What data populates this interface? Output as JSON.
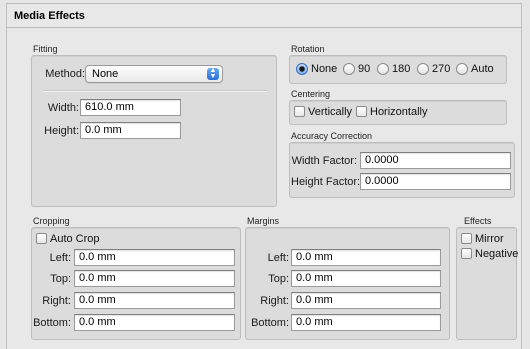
{
  "title": "Media Effects",
  "fitting": {
    "group_label": "Fitting",
    "method_label": "Method:",
    "method_value": "None",
    "width_label": "Width:",
    "width_value": "610.0 mm",
    "height_label": "Height:",
    "height_value": "0.0 mm"
  },
  "rotation": {
    "group_label": "Rotation",
    "options": [
      "None",
      "90",
      "180",
      "270",
      "Auto"
    ],
    "selected": "None"
  },
  "centering": {
    "group_label": "Centering",
    "vertically": "Vertically",
    "horizontally": "Horizontally"
  },
  "accuracy": {
    "group_label": "Accuracy Correction",
    "width_factor_label": "Width Factor:",
    "width_factor_value": "0.0000",
    "height_factor_label": "Height Factor:",
    "height_factor_value": "0.0000"
  },
  "cropping": {
    "group_label": "Cropping",
    "auto_crop": "Auto Crop",
    "left_label": "Left:",
    "left_value": "0.0 mm",
    "top_label": "Top:",
    "top_value": "0.0 mm",
    "right_label": "Right:",
    "right_value": "0.0 mm",
    "bottom_label": "Bottom:",
    "bottom_value": "0.0 mm"
  },
  "margins": {
    "group_label": "Margins",
    "left_label": "Left:",
    "left_value": "0.0 mm",
    "top_label": "Top:",
    "top_value": "0.0 mm",
    "right_label": "Right:",
    "right_value": "0.0 mm",
    "bottom_label": "Bottom:",
    "bottom_value": "0.0 mm"
  },
  "effects": {
    "group_label": "Effects",
    "mirror": "Mirror",
    "negative": "Negative"
  },
  "icons": {
    "select_arrows": "up-down-arrows-icon"
  }
}
